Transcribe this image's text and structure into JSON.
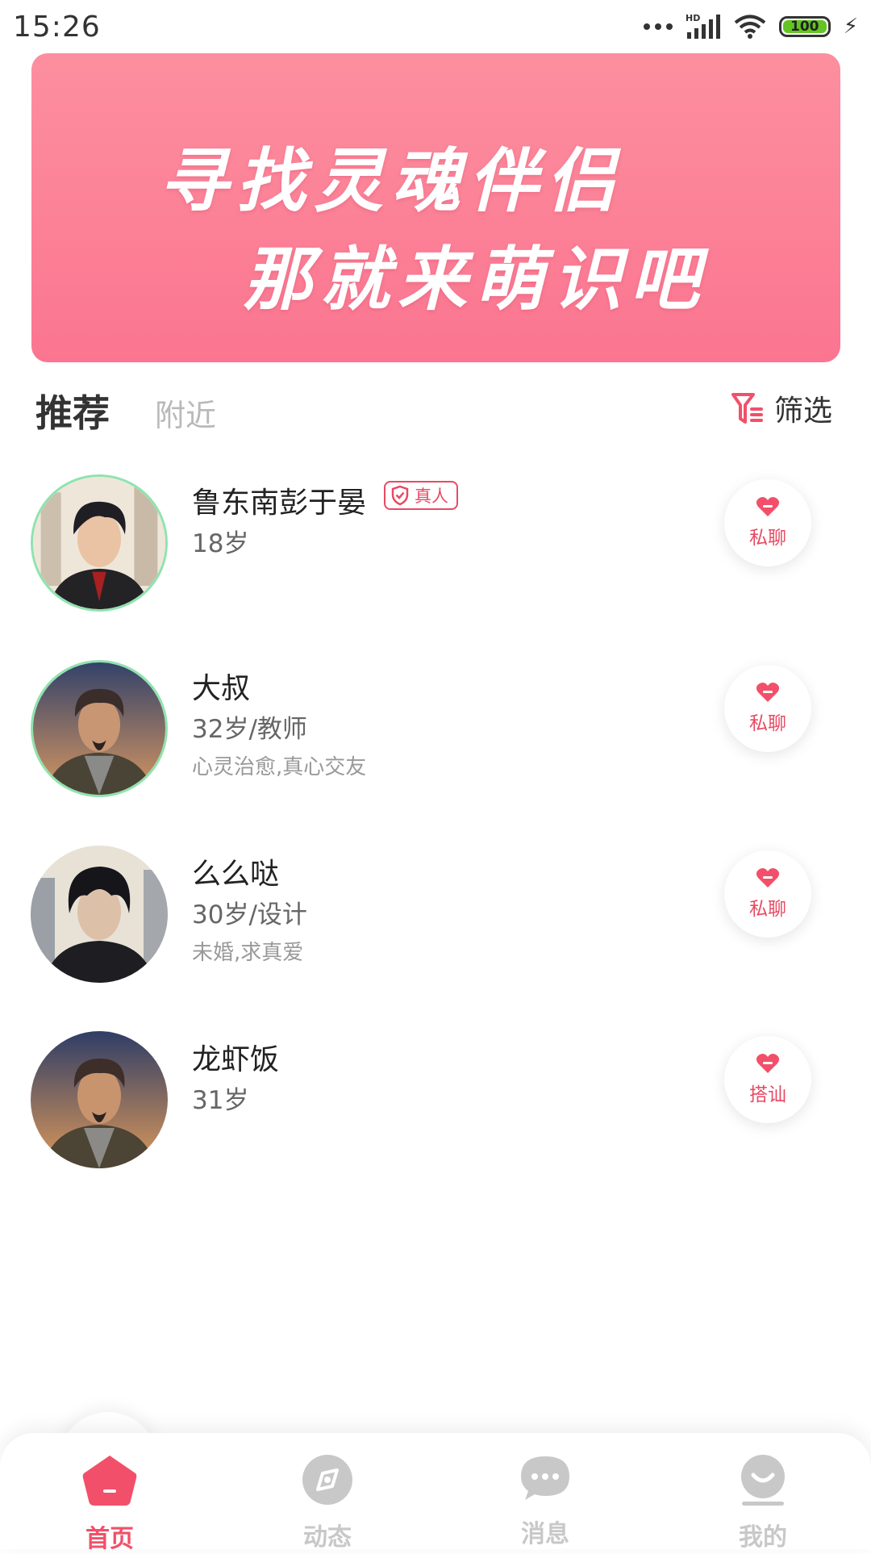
{
  "status_bar": {
    "time": "15:26",
    "battery": "100",
    "network": "HD"
  },
  "banner": {
    "line1": "寻找灵魂伴侣",
    "line2": "那就来萌识吧"
  },
  "tabs": {
    "recommend": "推荐",
    "nearby": "附近",
    "filter": "筛选"
  },
  "users": [
    {
      "name": "鲁东南彭于晏",
      "badge": "真人",
      "info": "18岁",
      "bio": "",
      "action": "私聊",
      "avatar_ring": true
    },
    {
      "name": "大叔",
      "badge": "",
      "info": "32岁/教师",
      "bio": "心灵治愈,真心交友",
      "action": "私聊",
      "avatar_ring": true
    },
    {
      "name": "么么哒",
      "badge": "",
      "info": "30岁/设计",
      "bio": "未婚,求真爱",
      "action": "私聊",
      "avatar_ring": false
    },
    {
      "name": "龙虾饭",
      "badge": "",
      "info": "31岁",
      "bio": "",
      "action": "搭讪",
      "avatar_ring": false
    }
  ],
  "bottom_nav": [
    {
      "label": "首页",
      "icon": "home-icon",
      "active": true
    },
    {
      "label": "动态",
      "icon": "compass-icon",
      "active": false
    },
    {
      "label": "消息",
      "icon": "message-icon",
      "active": false
    },
    {
      "label": "我的",
      "icon": "profile-icon",
      "active": false
    }
  ],
  "colors": {
    "accent": "#f2506a",
    "banner_top": "#fc8f9f",
    "banner_bottom": "#fb7590",
    "inactive": "#c8c8c8"
  }
}
